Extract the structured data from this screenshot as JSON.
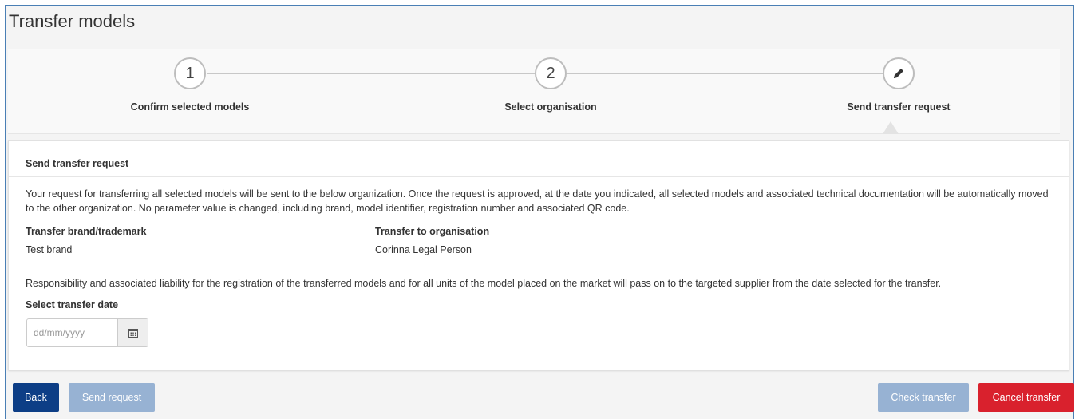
{
  "page": {
    "title": "Transfer models"
  },
  "stepper": {
    "steps": [
      {
        "number": "1",
        "label": "Confirm selected models",
        "state": "completed"
      },
      {
        "number": "2",
        "label": "Select organisation",
        "state": "completed"
      },
      {
        "icon": "pencil-icon",
        "label": "Send transfer request",
        "state": "active"
      }
    ]
  },
  "card": {
    "title": "Send transfer request",
    "intro": "Your request for transferring all selected models will be sent to the below organization. Once the request is approved, at the date you indicated, all selected models and associated technical documentation will be automatically moved to the other organization. No parameter value is changed, including brand, model identifier, registration number and associated QR code.",
    "brand_label": "Transfer brand/trademark",
    "brand_value": "Test brand",
    "org_label": "Transfer to organisation",
    "org_value": "Corinna Legal Person",
    "liability": "Responsibility and associated liability for the registration of the transferred models and for all units of the model placed on the market will pass on to the targeted supplier from the date selected for the transfer.",
    "date_label": "Select transfer date",
    "date_placeholder": "dd/mm/yyyy",
    "date_value": ""
  },
  "footer": {
    "back": "Back",
    "send": "Send request",
    "check": "Check transfer",
    "cancel": "Cancel transfer"
  },
  "colors": {
    "primary": "#0d3e86",
    "disabled": "#97b2d3",
    "danger": "#d9212d"
  }
}
